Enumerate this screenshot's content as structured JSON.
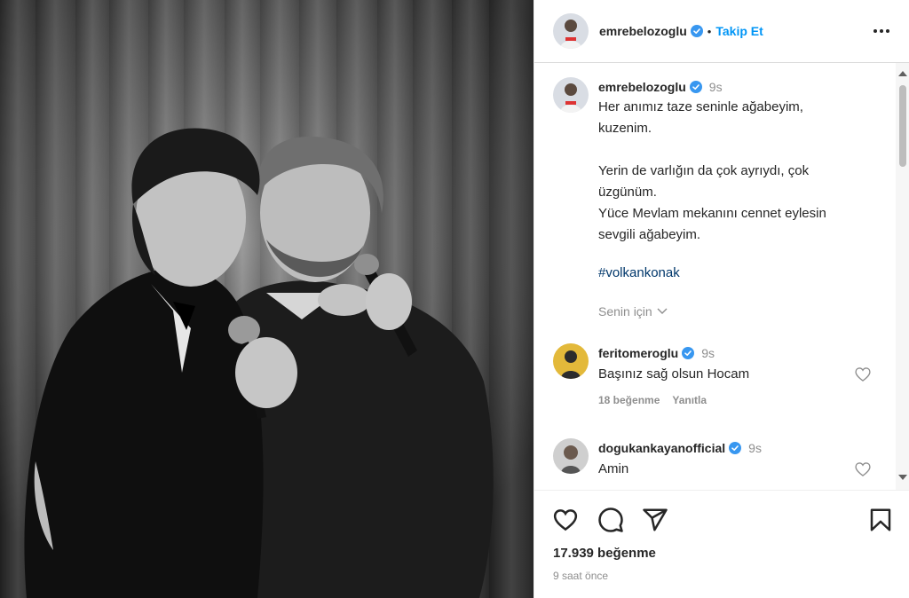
{
  "post": {
    "username": "emrebelozoglu",
    "follow_label": "Takip Et",
    "separator": "•"
  },
  "caption": {
    "username": "emrebelozoglu",
    "time": "9s",
    "line1": "Her anımız taze seninle ağabeyim,",
    "line2": "kuzenim.",
    "line3": "Yerin de varlığın da çok ayrıydı, çok",
    "line4": "üzgünüm.",
    "line5": "Yüce Mevlam mekanını cennet eylesin",
    "line6": "sevgili ağabeyim.",
    "hashtag": "#volkankonak",
    "translate_label": "Senin için"
  },
  "comments": [
    {
      "username": "feritomeroglu",
      "time": "9s",
      "text": "Başınız sağ olsun Hocam",
      "likes": "18 beğenme",
      "reply": "Yanıtla"
    },
    {
      "username": "dogukankayanofficial",
      "time": "9s",
      "text": "Amin"
    }
  ],
  "footer": {
    "likes": "17.939 beğenme",
    "time_ago": "9 saat önce"
  },
  "icons": {
    "verified": "verified-badge-icon",
    "more": "more-options-icon",
    "like": "heart-icon",
    "comment": "comment-bubble-icon",
    "share": "paper-plane-icon",
    "save": "bookmark-icon",
    "translate": "chevron-down-icon"
  },
  "colors": {
    "accent": "#0095f6",
    "verified": "#3897f0",
    "hashtag": "#00376b",
    "muted": "#8e8e8e",
    "text": "#262626"
  }
}
